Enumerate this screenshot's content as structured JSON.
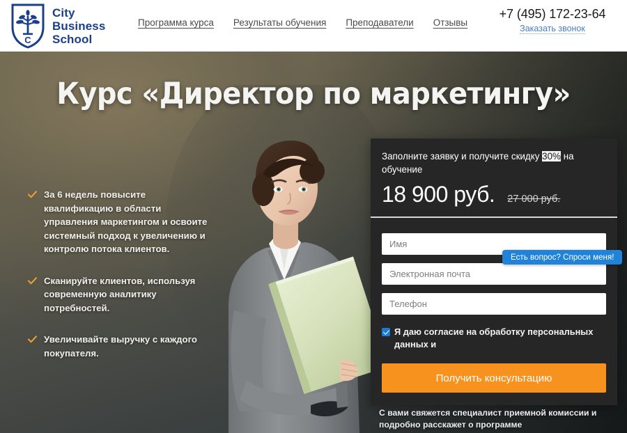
{
  "header": {
    "logo": {
      "icon": "shield-tree-icon",
      "monogram": "C",
      "line1": "City",
      "line2": "Business",
      "line3": "School"
    },
    "nav": [
      {
        "label": "Программа курса"
      },
      {
        "label": "Результаты обучения"
      },
      {
        "label": "Преподаватели"
      },
      {
        "label": "Отзывы"
      }
    ],
    "contact": {
      "phone": "+7 (495) 172-23-64",
      "callback_label": "Заказать звонок"
    }
  },
  "hero": {
    "title": "Курс «Директор по маркетингу»",
    "bullets": [
      {
        "icon": "check-icon",
        "text": "За 6 недель повысите квалификацию в области управления маркетингом и освоите системный подход к увеличению и контролю потока клиентов."
      },
      {
        "icon": "check-icon",
        "text": "Сканируйте клиентов, используя современную аналитику потребностей."
      },
      {
        "icon": "check-icon",
        "text": "Увеличивайте выручку с каждого покупателя."
      }
    ],
    "photo_alt": "businesswoman-with-folder"
  },
  "form_panel": {
    "offer_prefix": "Заполните заявку и получите скидку ",
    "offer_highlight": "30%",
    "offer_suffix": " на обучение",
    "price_new": "18 900 руб.",
    "price_old": "27 000 руб.",
    "fields": [
      {
        "name": "Имя",
        "placeholder": "Имя",
        "value": ""
      },
      {
        "name": "Электронная почта",
        "placeholder": "Электронная почта",
        "value": ""
      },
      {
        "name": "Телефон",
        "placeholder": "Телефон",
        "value": ""
      }
    ],
    "consent": {
      "checked": true,
      "text": "Я даю согласие на обработку персональных данных и"
    },
    "submit_label": "Получить консультацию",
    "note": "С вами свяжется специалист приемной комиссии и подробно расскажет о программе"
  },
  "chat_widget": {
    "tooltip": "Есть вопрос? Спроси меня!"
  },
  "colors": {
    "brand_blue": "#1c3f8b",
    "accent_orange": "#f7921e",
    "chat_blue": "#2083d8",
    "panel_bg": "#262626",
    "link_blue": "#4a7fc1"
  }
}
